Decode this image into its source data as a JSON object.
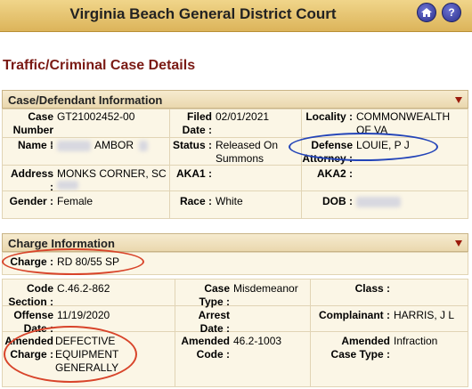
{
  "header": {
    "court_name": "Virginia Beach General District Court",
    "home_icon": "home-icon",
    "help_icon": "help-icon"
  },
  "page_title": "Traffic/Criminal Case Details",
  "case_section": {
    "title": "Case/Defendant Information",
    "fields": {
      "case_number_label": "Case Number :",
      "case_number": "GT21002452-00",
      "filed_label": "Filed Date :",
      "filed_date": "02/01/2021",
      "locality_label": "Locality :",
      "locality": "COMMONWEALTH OF VA",
      "name_label": "Name :",
      "name": "AMBOR",
      "status_label": "Status :",
      "status": "Released On Summons",
      "defense_label": "Defense Attorney :",
      "defense_attorney": "LOUIE, P J",
      "address_label": "Address :",
      "address": "MONKS CORNER, SC",
      "aka1_label": "AKA1 :",
      "aka2_label": "AKA2 :",
      "gender_label": "Gender :",
      "gender": "Female",
      "race_label": "Race :",
      "race": "White",
      "dob_label": "DOB :"
    }
  },
  "charge_section": {
    "title": "Charge Information",
    "fields": {
      "charge_label": "Charge :",
      "charge": "RD 80/55 SP",
      "code_label": "Code Section :",
      "code_section": "C.46.2-862",
      "case_type_label": "Case Type :",
      "case_type": "Misdemeanor",
      "class_label": "Class :",
      "offense_label": "Offense Date :",
      "offense_date": "11/19/2020",
      "arrest_label": "Arrest Date :",
      "complainant_label": "Complainant :",
      "complainant": "HARRIS, J L",
      "amended_charge_label": "Amended Charge :",
      "amended_charge": "DEFECTIVE EQUIPMENT GENERALLY",
      "amended_code_label": "Amended Code :",
      "amended_code": "46.2-1003",
      "amended_case_type_label": "Amended Case Type :",
      "amended_case_type": "Infraction"
    }
  },
  "colors": {
    "header_gold": "#dcb45a",
    "title_maroon": "#7a1a14",
    "annotation_red": "#d8442a",
    "annotation_blue": "#2344b8"
  }
}
